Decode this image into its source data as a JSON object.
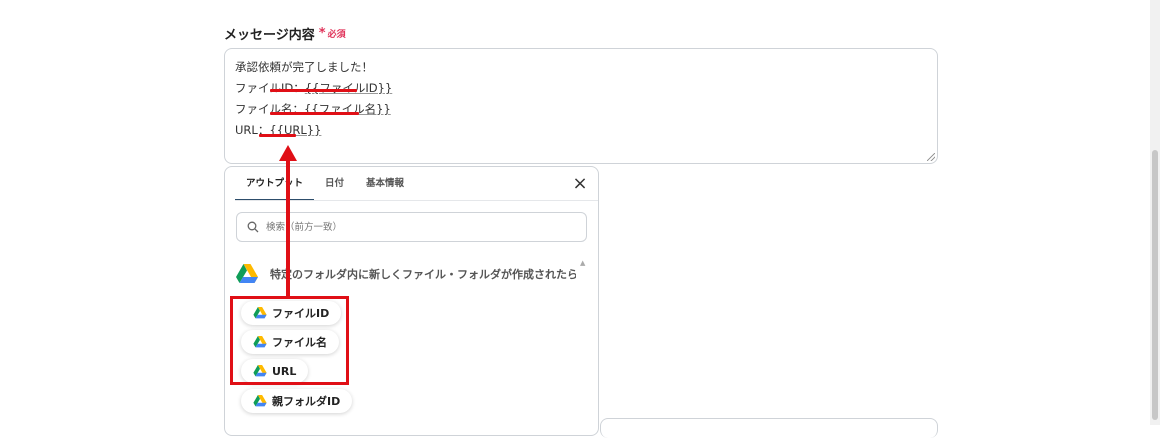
{
  "field": {
    "label": "メッセージ内容",
    "required_star": "*",
    "required_text": "必須",
    "message_lines": [
      {
        "prefix": "承認依頼が完了しました！",
        "var": ""
      },
      {
        "prefix": "ファイルID：",
        "var": "{{ファイルID}}"
      },
      {
        "prefix": "ファイル名：",
        "var": "{{ファイル名}}"
      },
      {
        "prefix": "URL：",
        "var": "{{URL}}"
      }
    ]
  },
  "panel": {
    "tabs": [
      "アウトプット",
      "日付",
      "基本情報"
    ],
    "active_tab": "アウトプット",
    "close_label": "×",
    "search_placeholder": "検索（前方一致）",
    "group_title": "特定のフォルダ内に新しくファイル・フォルダが作成されたら",
    "items": [
      "ファイルID",
      "ファイル名",
      "URL",
      "親フォルダID"
    ]
  },
  "icons": {
    "drive": "google-drive-icon",
    "search": "search-icon",
    "close": "close-icon"
  },
  "colors": {
    "annotation_red": "#e00f16",
    "required_pink": "#e0335a",
    "tab_underline": "#2d4d6b"
  }
}
